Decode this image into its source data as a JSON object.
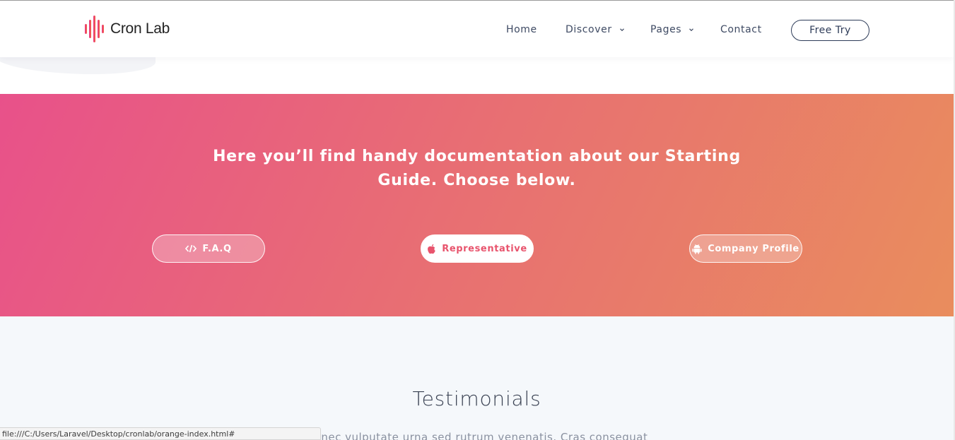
{
  "brand": {
    "name": "Cron Lab",
    "colors": [
      "#e8318a",
      "#f04c56",
      "#f4663e"
    ]
  },
  "nav": {
    "home": "Home",
    "discover": "Discover",
    "pages": "Pages",
    "contact": "Contact",
    "cta": "Free Try"
  },
  "guide": {
    "heading": "Here you’ll find handy documentation about our Starting Guide. Choose below.",
    "buttons": {
      "faq": {
        "label": "F.A.Q",
        "icon": "code-icon"
      },
      "representative": {
        "label": "Representative",
        "icon": "apple-icon"
      },
      "company": {
        "label": "Company Profile",
        "icon": "android-icon"
      }
    },
    "gradient": [
      "#e8518a",
      "#e86d74",
      "#e98d5d"
    ]
  },
  "testimonials": {
    "title": "Testimonials",
    "subtitle": "Donec vulputate urna sed rutrum venenatis. Cras consequat"
  },
  "status_url": "file:///C:/Users/Laravel/Desktop/cronlab/orange-index.html#"
}
